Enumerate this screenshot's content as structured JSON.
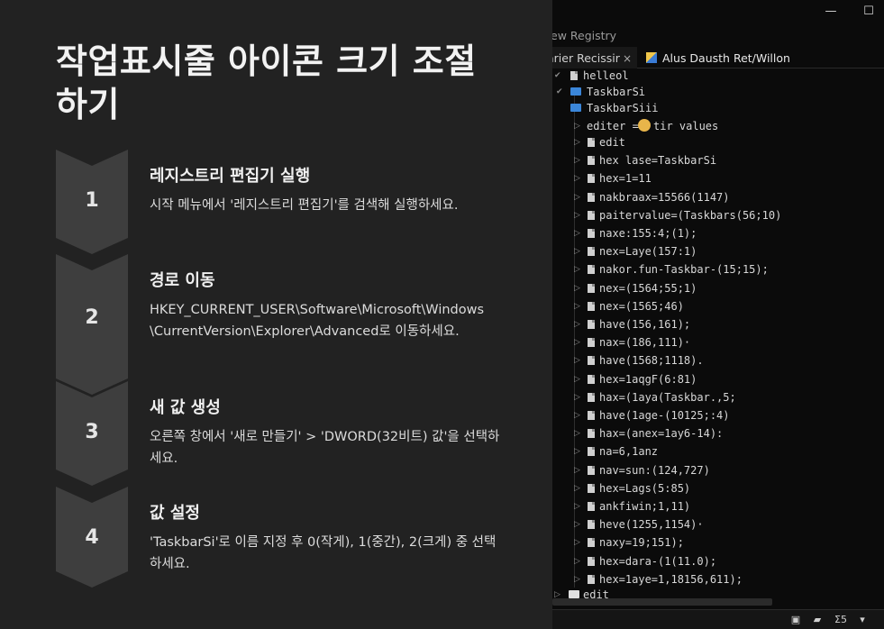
{
  "guide": {
    "title": "작업표시줄 아이콘 크기 조절하기",
    "steps": [
      {
        "number": "1",
        "title": "레지스트리 편집기 실행",
        "description": "시작 메뉴에서 '레지스트리 편집기'를 검색해 실행하세요."
      },
      {
        "number": "2",
        "title": "경로 이동",
        "description": "HKEY_CURRENT_USER\\Software\\Microsoft\\Windows\\CurrentVersion\\Explorer\\Advanced로 이동하세요."
      },
      {
        "number": "3",
        "title": "새 값 생성",
        "description": "오른쪽 창에서 '새로 만들기' > 'DWORD(32비트) 값'을 선택하세요."
      },
      {
        "number": "4",
        "title": "값 설정",
        "description": "'TaskbarSi'로 이름 지정 후 0(작게), 1(중간), 2(크게) 중 선택하세요."
      }
    ]
  },
  "registry": {
    "app_title": "ew Registry",
    "window_controls": {
      "minimize": "—",
      "maximize": "☐"
    },
    "tabs": [
      {
        "label": "arier Recissir",
        "close": "×"
      },
      {
        "label": "Alus Dausth Ret/Willon"
      }
    ],
    "tree": {
      "root": "helleol",
      "key": "TaskbarSi",
      "subkey": "TaskbarSiii",
      "editor_label": "editer =:",
      "editor_value": "tir values",
      "items": [
        "edit",
        "hex lase=TaskbarSi",
        "hex=1=11",
        "nakbraax=15566(1147)",
        "paitervalue=(Taskbars(56;10)",
        "naxe:155:4;(1);",
        "nex=Laye(157:1)",
        "nakor.fun-Taskbar-(15;15);",
        "nex=(1564;55;1)",
        "nex=(1565;46)",
        "have(156,161);",
        "nax=(186,111)·",
        "have(1568;1118).",
        "hex=1aqgF(6:81)",
        "hax=(1aya(Taskbar.,5;",
        "have(1age-(10125;:4)",
        "hax=(anex=1ay6-14):",
        "na=6,1anz",
        "nav=sun:(124,727)",
        "hex=Lags(5:85)",
        "ankfiwin;1,11)",
        "heve(1255,1154)·",
        "naxy=19;151);",
        "hex=dara-(1(11.0);",
        "hex=1aye=1,18156,611);"
      ],
      "footer_item": "edit"
    },
    "status_icons": [
      "doc-icon",
      "folder-icon",
      "sort-icon",
      "chevron-down-icon"
    ],
    "status_text": [
      "",
      "",
      "Σ5",
      "▾"
    ]
  }
}
